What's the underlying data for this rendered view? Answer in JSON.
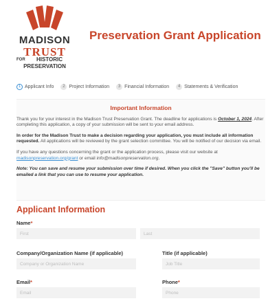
{
  "header": {
    "logo": {
      "madison": "MADISON",
      "trust": "TRUST",
      "for": "FOR",
      "historic": "HISTORIC",
      "preservation": "PRESERVATION",
      "brand_color": "#c8452a"
    },
    "title": "Preservation Grant Application"
  },
  "steps": [
    {
      "number": "1",
      "label": "Applicant Info",
      "active": true
    },
    {
      "number": "2",
      "label": "Project Information",
      "active": false
    },
    {
      "number": "3",
      "label": "Financial Information",
      "active": false
    },
    {
      "number": "4",
      "label": "Statements & Verification",
      "active": false
    }
  ],
  "important": {
    "title": "Important Information",
    "p1_before": "Thank you for your interest in the Madison Trust Preservation Grant. The deadline for applications is ",
    "p1_deadline": "October 1, 2024",
    "p1_after": ". After completing this application, a copy of your submission will be sent to your email address.",
    "p2_bold": "In order for the Madison Trust to make a decision regarding your application, you must include all information requested.",
    "p2_rest": " All applications will be reviewed by the grant selection committee. You will be notified of our decision via email.",
    "p3_before": "If you have any questions concerning the grant or the application process, please visit our website at ",
    "p3_link": "madisonpreservation.org/grant",
    "p3_middle": " or email ",
    "p3_email": "info@madisonpreservation.org",
    "p3_end": ".",
    "note": "Note: You can save and resume your submission over time if desired. When you click the \"Save\" button you'll be emailed a link that you can use to resume your application."
  },
  "form": {
    "section_title": "Applicant Information",
    "name_label": "Name",
    "first_placeholder": "First",
    "last_placeholder": "Last",
    "company_label": "Company/Organization Name (if applicable)",
    "company_placeholder": "Company or Organization Name",
    "title_label": "Title (if applicable)",
    "title_placeholder": "Job Title",
    "email_label": "Email",
    "email_placeholder": "Email",
    "phone_label": "Phone",
    "phone_placeholder": "Phone",
    "required_mark": "*"
  }
}
